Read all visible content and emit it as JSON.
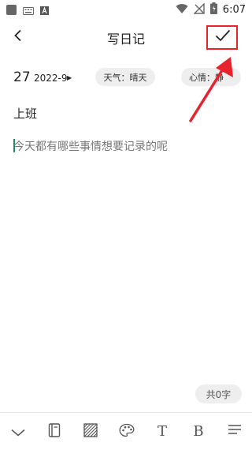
{
  "status_bar": {
    "time": "6:07",
    "icons": [
      "app-square-icon",
      "keyboard-icon",
      "a-icon",
      "wifi-icon",
      "no-signal-icon",
      "battery-icon"
    ]
  },
  "header": {
    "title": "写日记",
    "back_icon": "chevron-left-icon",
    "confirm_icon": "checkmark-icon"
  },
  "entry": {
    "day": "27",
    "year_month": "2022-9",
    "weather_label": "天气：晴天",
    "mood_label": "心情：",
    "mood_value_partial": "静",
    "title": "上班",
    "body_placeholder": "今天都有哪些事情想要记录的呢"
  },
  "word_count": "共0字",
  "toolbar": {
    "items": [
      "collapse-icon",
      "notebook-icon",
      "texture-icon",
      "palette-icon",
      "text-style-icon",
      "bold-icon",
      "align-icon"
    ],
    "text_style_glyph": "T",
    "bold_glyph": "B"
  },
  "annotation": {
    "color": "#e8232e"
  }
}
